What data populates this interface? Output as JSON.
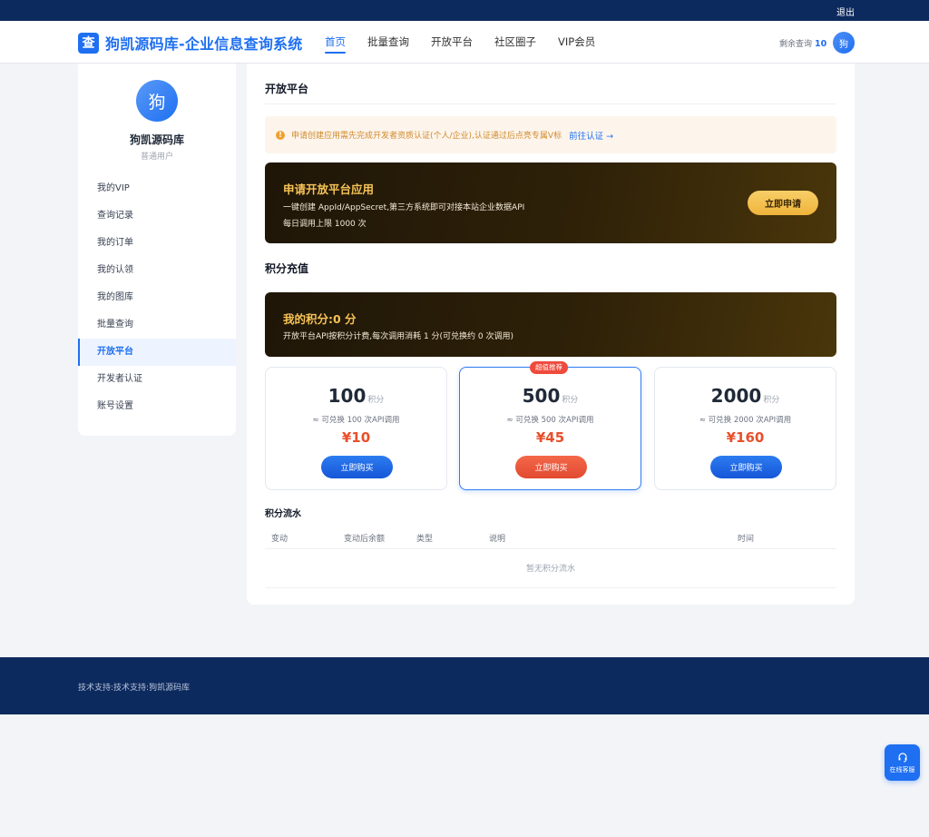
{
  "topbar": {
    "logout": "退出"
  },
  "header": {
    "logo_char": "查",
    "title": "狗凯源码库-企业信息查询系统",
    "nav": [
      {
        "label": "首页",
        "active": true
      },
      {
        "label": "批量查询"
      },
      {
        "label": "开放平台"
      },
      {
        "label": "社区圈子"
      },
      {
        "label": "VIP会员"
      }
    ],
    "quota_label": "剩余查询",
    "quota_value": "10",
    "avatar_char": "狗"
  },
  "sidebar": {
    "avatar_char": "狗",
    "username": "狗凯源码库",
    "role": "普通用户",
    "menu": [
      {
        "label": "我的VIP"
      },
      {
        "label": "查询记录"
      },
      {
        "label": "我的订单"
      },
      {
        "label": "我的认领"
      },
      {
        "label": "我的图库"
      },
      {
        "label": "批量查询"
      },
      {
        "label": "开放平台",
        "active": true
      },
      {
        "label": "开发者认证"
      },
      {
        "label": "账号设置"
      }
    ]
  },
  "main": {
    "title": "开放平台",
    "notice": {
      "icon": "!",
      "text": "申请创建应用需先完成开发者资质认证(个人/企业),认证通过后点亮专属V标",
      "link": "前往认证 →"
    },
    "apply_card": {
      "title": "申请开放平台应用",
      "desc": "一键创建 AppId/AppSecret,第三方系统即可对接本站企业数据API",
      "limit": "每日调用上限 1000 次",
      "button": "立即申请"
    },
    "recharge_title": "积分充值",
    "points_card": {
      "title": "我的积分:0 分",
      "desc": "开放平台API按积分计费,每次调用消耗 1 分(可兑换约 0 次调用)"
    },
    "packages": [
      {
        "points": "100",
        "unit": "积分",
        "desc": "≈ 可兑换 100 次API调用",
        "price": "¥10",
        "button": "立即购买"
      },
      {
        "points": "500",
        "unit": "积分",
        "desc": "≈ 可兑换 500 次API调用",
        "price": "¥45",
        "button": "立即购买",
        "badge": "超值推荐"
      },
      {
        "points": "2000",
        "unit": "积分",
        "desc": "≈ 可兑换 2000 次API调用",
        "price": "¥160",
        "button": "立即购买"
      }
    ],
    "log": {
      "title": "积分流水",
      "columns": [
        "变动",
        "变动后余额",
        "类型",
        "说明",
        "时间"
      ],
      "empty": "暂无积分流水"
    }
  },
  "footer": {
    "text": "技术支持:技术支持:狗凯源码库"
  },
  "customer_service": {
    "label": "在线客服"
  },
  "colors": {
    "primary": "#1e6ff1",
    "dark_nav": "#0d2a5e",
    "gold": "#f7c356",
    "price": "#e8502c"
  }
}
